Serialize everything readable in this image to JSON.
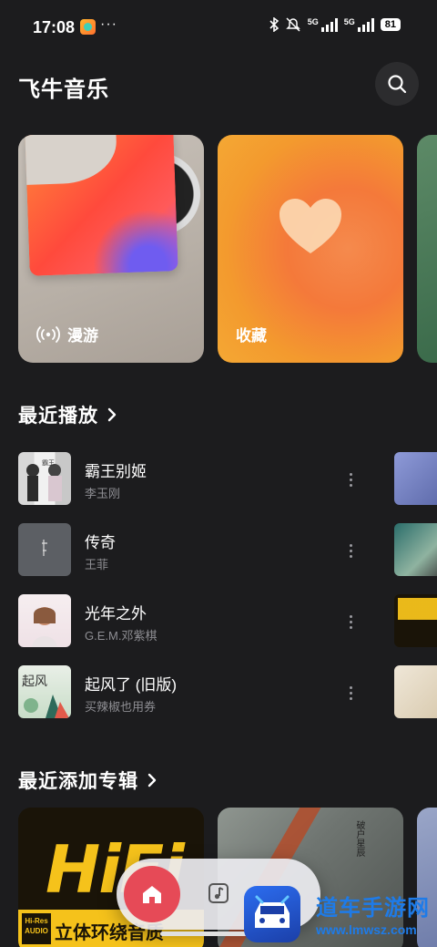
{
  "status_bar": {
    "time": "17:08",
    "more": "···",
    "signal_1": "5G",
    "signal_2": "5G",
    "battery": "81"
  },
  "header": {
    "title": "飞牛音乐"
  },
  "feature_cards": [
    {
      "label": "漫游",
      "icon": "radio-wave-icon"
    },
    {
      "label": "收藏",
      "icon": "heart-icon"
    }
  ],
  "recent_played": {
    "title": "最近播放",
    "songs": [
      {
        "title": "霸王别姬",
        "artist": "李玉刚"
      },
      {
        "title": "传奇",
        "artist": "王菲"
      },
      {
        "title": "光年之外",
        "artist": "G.E.M.邓紫棋"
      },
      {
        "title": "起风了 (旧版)",
        "artist": "买辣椒也用券"
      }
    ]
  },
  "recent_albums": {
    "title": "最近添加专辑",
    "albums": [
      {
        "cover_big": "HiFi",
        "cover_strip": "立体环绕音质",
        "cover_badge": "Hi-Res AUDIO"
      },
      {
        "cover_text": "破户星辰"
      }
    ]
  },
  "nav": {
    "items": [
      "home-icon",
      "music-note-icon"
    ]
  },
  "watermark": {
    "title": "道车手游网",
    "url": "www.lmwsz.com"
  },
  "colors": {
    "background": "#1c1c1e",
    "accent": "#e64a57",
    "favorite": "#f4793a"
  }
}
